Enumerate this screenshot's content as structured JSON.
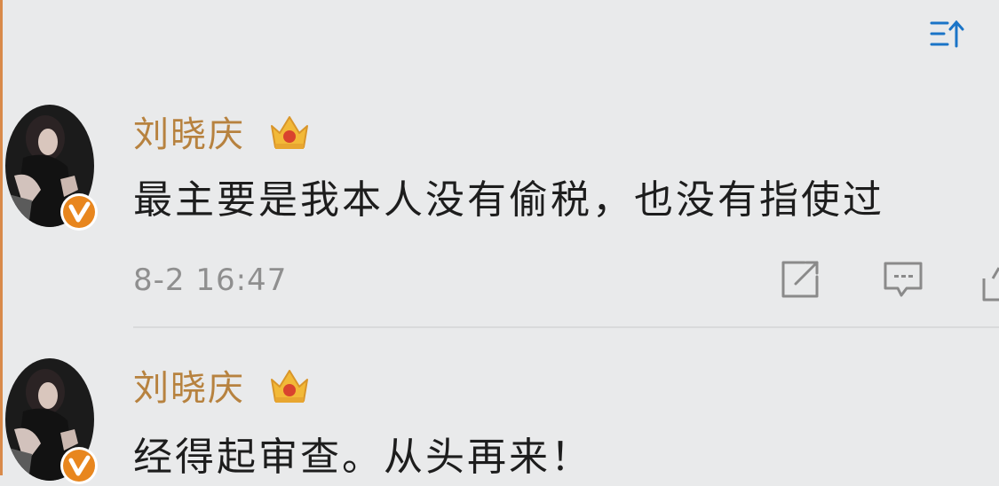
{
  "toolbar": {
    "sort_icon": "sort-up-icon"
  },
  "posts": [
    {
      "username": "刘晓庆",
      "badge_icon": "crown-badge-icon",
      "verified_icon": "verified-v-icon",
      "content": "最主要是我本人没有偷税，也没有指使过",
      "timestamp": "8-2 16:47",
      "actions": [
        "share-icon",
        "comment-icon",
        "like-icon"
      ]
    },
    {
      "username": "刘晓庆",
      "badge_icon": "crown-badge-icon",
      "verified_icon": "verified-v-icon",
      "content": "经得起审查。从头再来！"
    }
  ],
  "colors": {
    "background": "#e9eaeb",
    "username": "#b7823f",
    "content": "#1d1d1d",
    "timestamp": "#8f8f8f",
    "crown": "#f2b938",
    "verified": "#e8861e"
  }
}
